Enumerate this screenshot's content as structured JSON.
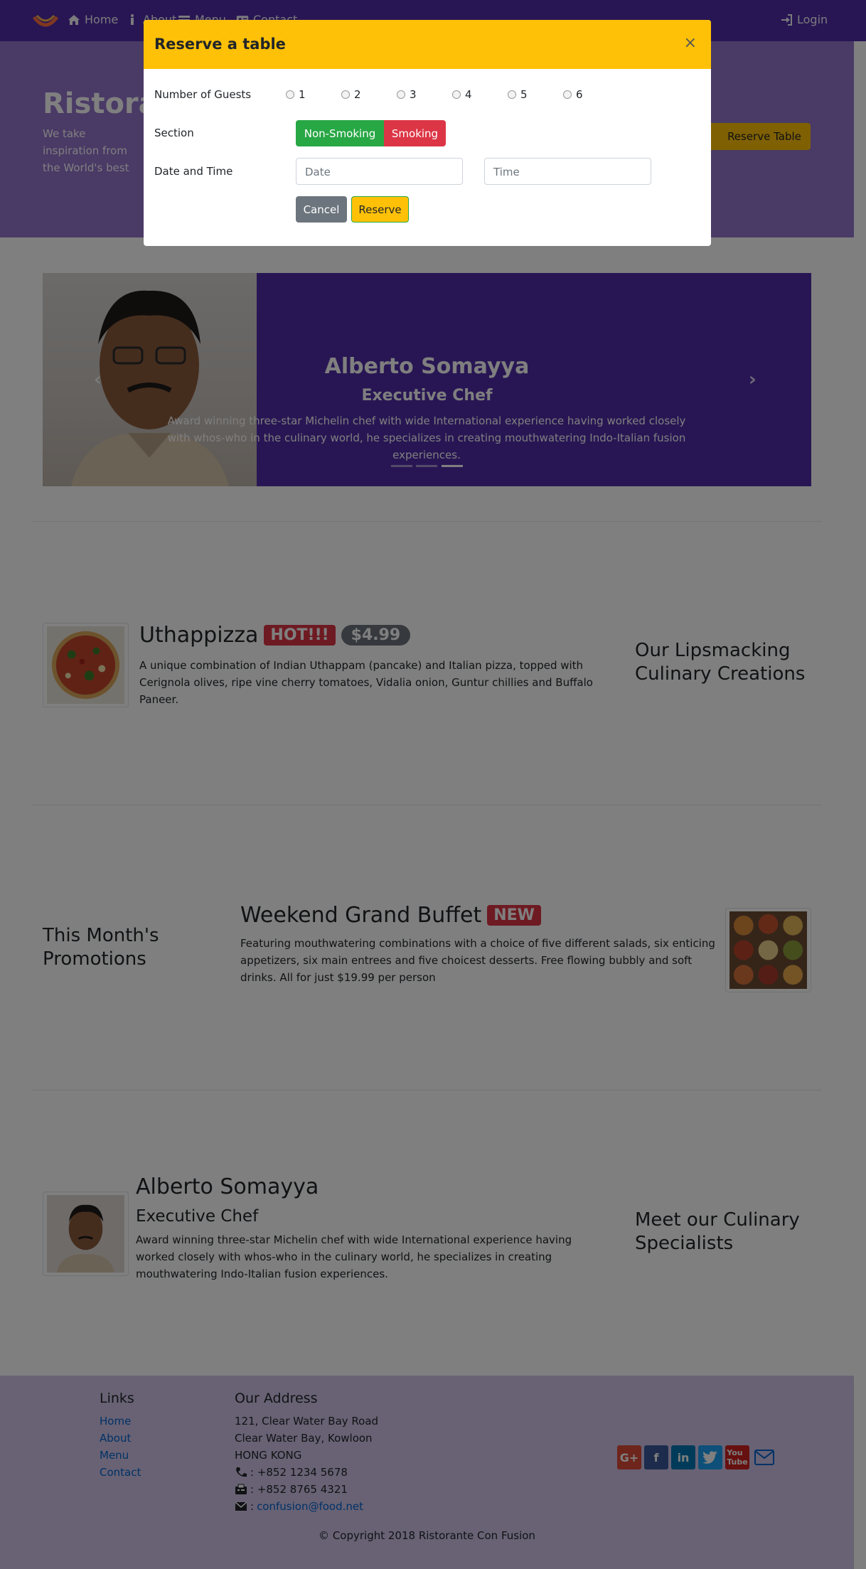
{
  "nav": {
    "items": [
      {
        "label": "Home",
        "icon": "home-icon"
      },
      {
        "label": "About",
        "icon": "info-icon"
      },
      {
        "label": "Menu",
        "icon": "list-icon"
      },
      {
        "label": "Contact",
        "icon": "address-card-icon"
      }
    ],
    "login_label": "Login"
  },
  "jumbotron": {
    "title": "Ristorante con Fusion",
    "text": "We take inspiration from the World's best cuisines, and create a unique fusion experience. Our lipsmacking creations will tickle your culinary senses!",
    "reserve_label": "Reserve Table"
  },
  "carousel": {
    "name": "Alberto Somayya",
    "role": "Executive Chef",
    "description": "Award winning three-star Michelin chef with wide International experience having worked closely with whos-who in the culinary world, he specializes in creating mouthwatering Indo-Italian fusion experiences.",
    "indicators": 3,
    "active_indicator": 2
  },
  "dish": {
    "name": "Uthappizza",
    "badge": "HOT!!!",
    "price": "$4.99",
    "description": "A unique combination of Indian Uthappam (pancake) and Italian pizza, topped with Cerignola olives, ripe vine cherry tomatoes, Vidalia onion, Guntur chillies and Buffalo Paneer.",
    "side_heading": "Our Lipsmacking Culinary Creations"
  },
  "promotion": {
    "side_heading": "This Month's Promotions",
    "name": "Weekend Grand Buffet",
    "badge": "NEW",
    "description": "Featuring mouthwatering combinations with a choice of five different salads, six enticing appetizers, six main entrees and five choicest desserts. Free flowing bubbly and soft drinks. All for just $19.99 per person"
  },
  "leader": {
    "name": "Alberto Somayya",
    "role": "Executive Chef",
    "description": "Award winning three-star Michelin chef with wide International experience having worked closely with whos-who in the culinary world, he specializes in creating mouthwatering Indo-Italian fusion experiences.",
    "side_heading": "Meet our Culinary Specialists"
  },
  "footer": {
    "links_heading": "Links",
    "links": [
      "Home",
      "About",
      "Menu",
      "Contact"
    ],
    "address_heading": "Our Address",
    "address": [
      "121, Clear Water Bay Road",
      "Clear Water Bay, Kowloon",
      "HONG KONG"
    ],
    "phone": ": +852 1234 5678",
    "fax": ": +852 8765 4321",
    "email": "confusion@food.net",
    "copyright": "© Copyright 2018 Ristorante Con Fusion"
  },
  "modal": {
    "title": "Reserve a table",
    "close": "×",
    "guests_label": "Number of Guests",
    "guest_options": [
      "1",
      "2",
      "3",
      "4",
      "5",
      "6"
    ],
    "section_label": "Section",
    "non_smoking": "Non-Smoking",
    "smoking": "Smoking",
    "datetime_label": "Date and Time",
    "date_placeholder": "Date",
    "time_placeholder": "Time",
    "cancel": "Cancel",
    "reserve": "Reserve"
  },
  "colors": {
    "primary": "#512DA8",
    "jumbotron": "#9575CD",
    "footer": "#D1C4E9",
    "accent": "#FFC107",
    "danger": "#DC3545",
    "success": "#28A745",
    "secondary": "#6C757D"
  }
}
